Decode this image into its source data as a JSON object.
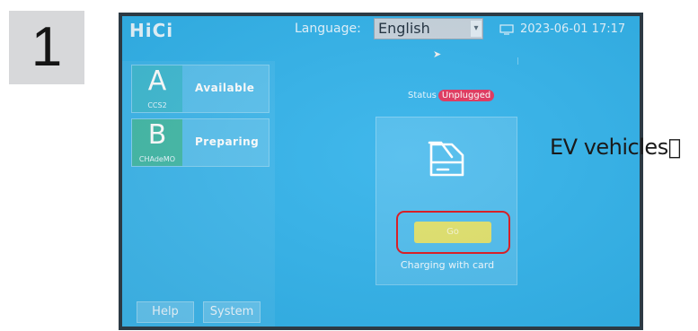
{
  "step": {
    "number": "1"
  },
  "header": {
    "logo": "HiCi",
    "language_label": "Language:",
    "language_value": "English",
    "datetime": "2023-06-01 17:17"
  },
  "connectors": [
    {
      "letter": "A",
      "type": "CCS2",
      "status": "Available"
    },
    {
      "letter": "B",
      "type": "CHAdeMO",
      "status": "Preparing"
    }
  ],
  "footer": {
    "help_label": "Help",
    "system_label": "System"
  },
  "main": {
    "status_label": "Status",
    "status_value": "Unplugged",
    "go_label": "Go",
    "card_caption": "Charging with card"
  },
  "caption": "EV vehicles\u0000",
  "colors": {
    "screen_bg": "#31b2ea",
    "status_badge": "#e0335b",
    "go_button": "#dfe06a",
    "highlight": "#d72027"
  },
  "icons": [
    "screen-icon",
    "cursor-icon",
    "card-reader-icon",
    "chevron-down-icon"
  ]
}
